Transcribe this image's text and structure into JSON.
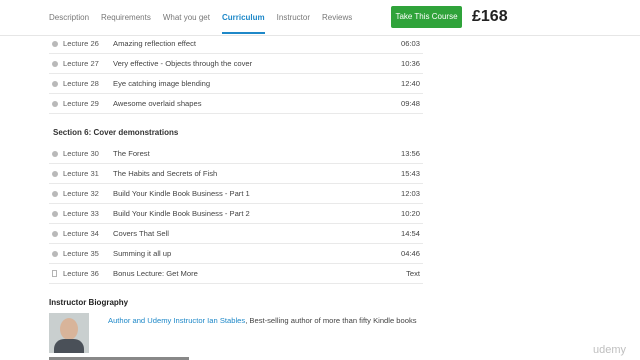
{
  "nav": {
    "items": [
      {
        "label": "Description",
        "active": false
      },
      {
        "label": "Requirements",
        "active": false
      },
      {
        "label": "What you get",
        "active": false
      },
      {
        "label": "Curriculum",
        "active": true
      },
      {
        "label": "Instructor",
        "active": false
      },
      {
        "label": "Reviews",
        "active": false
      }
    ],
    "cta_label": "Take This Course",
    "price": "£168"
  },
  "section5_lectures": [
    {
      "number": "Lecture 26",
      "title": "Amazing reflection effect",
      "duration": "06:03"
    },
    {
      "number": "Lecture 27",
      "title": "Very effective - Objects through the cover",
      "duration": "10:36"
    },
    {
      "number": "Lecture 28",
      "title": "Eye catching image blending",
      "duration": "12:40"
    },
    {
      "number": "Lecture 29",
      "title": "Awesome overlaid shapes",
      "duration": "09:48"
    }
  ],
  "section6": {
    "title": "Section 6: Cover demonstrations",
    "lectures": [
      {
        "number": "Lecture 30",
        "title": "The Forest",
        "duration": "13:56"
      },
      {
        "number": "Lecture 31",
        "title": "The Habits and Secrets of Fish",
        "duration": "15:43"
      },
      {
        "number": "Lecture 32",
        "title": "Build Your Kindle Book Business - Part 1",
        "duration": "12:03"
      },
      {
        "number": "Lecture 33",
        "title": "Build Your Kindle Book Business - Part 2",
        "duration": "10:20"
      },
      {
        "number": "Lecture 34",
        "title": "Covers That Sell",
        "duration": "14:54"
      },
      {
        "number": "Lecture 35",
        "title": "Summing it all up",
        "duration": "04:46"
      },
      {
        "number": "Lecture 36",
        "title": "Bonus Lecture: Get More",
        "duration": "Text"
      }
    ]
  },
  "bio": {
    "heading": "Instructor Biography",
    "link_text": "Author and Udemy Instructor Ian Stables",
    "rest_text": ", Best-selling author of more than fifty Kindle books"
  },
  "watermark": "udemy"
}
